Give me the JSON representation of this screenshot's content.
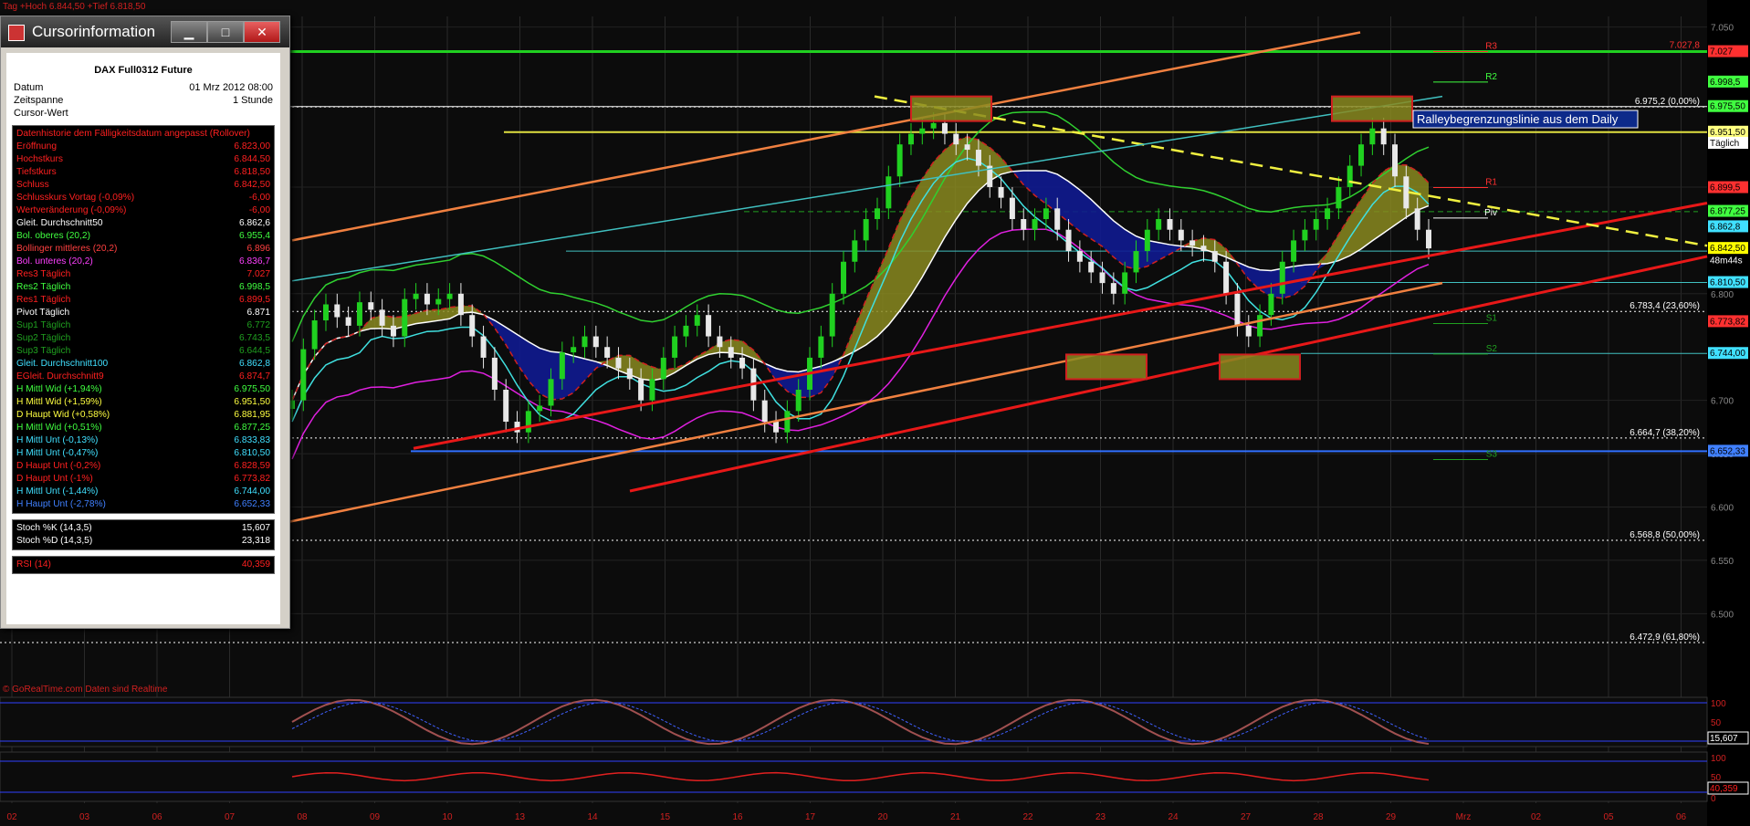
{
  "header": {
    "top_line": "Tag +Hoch 6.844,50 +Tief 6.818,50"
  },
  "footer_source": "© GoRealTime.com   Daten sind Realtime",
  "annotation": "Ralleybegrenzungslinie aus dem Daily",
  "window": {
    "title": "Cursorinformation",
    "min": "▁",
    "max": "□",
    "close": "✕",
    "instrument": "DAX Full0312 Future",
    "meta": [
      {
        "label": "Datum",
        "value": "01 Mrz 2012 08:00"
      },
      {
        "label": "Zeitspanne",
        "value": "1 Stunde"
      },
      {
        "label": "Cursor-Wert",
        "value": ""
      }
    ],
    "section1": [
      {
        "label": "Datenhistorie dem Fälligkeitsdatum angepasst (Rollover)",
        "value": "",
        "color": "#ff2020"
      },
      {
        "label": "Eröffnung",
        "value": "6.823,00",
        "color": "#ff2020"
      },
      {
        "label": "Hochstkurs",
        "value": "6.844,50",
        "color": "#ff2020"
      },
      {
        "label": "Tiefstkurs",
        "value": "6.818,50",
        "color": "#ff2020"
      },
      {
        "label": "Schluss",
        "value": "6.842,50",
        "color": "#ff2020"
      },
      {
        "label": "Schlusskurs Vortag (-0,09%)",
        "value": "-6,00",
        "color": "#ff2020"
      },
      {
        "label": "Wertveränderung (-0,09%)",
        "value": "-6,00",
        "color": "#ff2020"
      },
      {
        "label": "Gleit. Durchschnitt50",
        "value": "6.862,6",
        "color": "#ffffff"
      },
      {
        "label": "Bol. oberes (20,2)",
        "value": "6.955,4",
        "color": "#40ff40"
      },
      {
        "label": "Bollinger mittleres (20,2)",
        "value": "6.896",
        "color": "#ff4040"
      },
      {
        "label": "Bol. unteres (20,2)",
        "value": "6.836,7",
        "color": "#ff40ff"
      },
      {
        "label": "Res3 Täglich",
        "value": "7.027",
        "color": "#ff2020"
      },
      {
        "label": "Res2 Täglich",
        "value": "6.998,5",
        "color": "#40ff40"
      },
      {
        "label": "Res1 Täglich",
        "value": "6.899,5",
        "color": "#ff2020"
      },
      {
        "label": "Pivot Täglich",
        "value": "6.871",
        "color": "#ffffff"
      },
      {
        "label": "Sup1 Täglich",
        "value": "6.772",
        "color": "#20a020"
      },
      {
        "label": "Sup2 Täglich",
        "value": "6.743,5",
        "color": "#20a020"
      },
      {
        "label": "Sup3 Täglich",
        "value": "6.644,5",
        "color": "#20a020"
      },
      {
        "label": "Gleit. Durchschnitt100",
        "value": "6.862,8",
        "color": "#40e0ff"
      },
      {
        "label": "EGleit. Durchschnitt9",
        "value": "6.874,7",
        "color": "#ff2020"
      },
      {
        "label": "H Mittl Wid (+1,94%)",
        "value": "6.975,50",
        "color": "#40ff40"
      },
      {
        "label": "H Mittl Wid (+1,59%)",
        "value": "6.951,50",
        "color": "#ffff40"
      },
      {
        "label": "D Haupt Wid (+0,58%)",
        "value": "6.881,95",
        "color": "#ffff40"
      },
      {
        "label": "H Mittl Wid (+0,51%)",
        "value": "6.877,25",
        "color": "#40ff40"
      },
      {
        "label": "H Mittl Unt (-0,13%)",
        "value": "6.833,83",
        "color": "#40e0ff"
      },
      {
        "label": "H Mittl Unt (-0,47%)",
        "value": "6.810,50",
        "color": "#40e0ff"
      },
      {
        "label": "D Haupt Unt (-0,2%)",
        "value": "6.828,59",
        "color": "#ff2020"
      },
      {
        "label": "D Haupt Unt (-1%)",
        "value": "6.773,82",
        "color": "#ff2020"
      },
      {
        "label": "H Mittl Unt (-1,44%)",
        "value": "6.744,00",
        "color": "#40e0ff"
      },
      {
        "label": "H Haupt Unt (-2,78%)",
        "value": "6.652,33",
        "color": "#4080ff"
      }
    ],
    "section2": [
      {
        "label": "Stoch %K (14,3,5)",
        "value": "15,607",
        "color": "#ffffff"
      },
      {
        "label": "Stoch %D (14,3,5)",
        "value": "23,318",
        "color": "#ffffff"
      }
    ],
    "section3": [
      {
        "label": "RSI (14)",
        "value": "40,359",
        "color": "#ff2020"
      }
    ]
  },
  "chart_data": {
    "type": "candlestick",
    "instrument": "DAX Full0312 Future",
    "timeframe": "1 Stunde",
    "x_tick_labels": [
      "02",
      "03",
      "06",
      "07",
      "08",
      "09",
      "10",
      "13",
      "14",
      "15",
      "16",
      "17",
      "20",
      "21",
      "22",
      "23",
      "24",
      "27",
      "28",
      "29",
      "Mrz",
      "02",
      "05",
      "06"
    ],
    "y_axis_labels": [
      {
        "label": "7.050",
        "y": 7050
      },
      {
        "label": "6.900",
        "y": 6900
      },
      {
        "label": "6.800",
        "y": 6800
      },
      {
        "label": "6.700",
        "y": 6700
      },
      {
        "label": "6.650",
        "y": 6650
      },
      {
        "label": "6.600",
        "y": 6600
      },
      {
        "label": "6.550",
        "y": 6550
      },
      {
        "label": "6.500",
        "y": 6500
      }
    ],
    "ylim": [
      6425,
      7060
    ],
    "closes": [
      6700,
      6748,
      6775,
      6790,
      6778,
      6770,
      6792,
      6785,
      6770,
      6760,
      6795,
      6800,
      6790,
      6795,
      6800,
      6780,
      6760,
      6740,
      6710,
      6680,
      6670,
      6690,
      6695,
      6720,
      6745,
      6750,
      6760,
      6750,
      6740,
      6730,
      6720,
      6700,
      6720,
      6740,
      6760,
      6770,
      6780,
      6760,
      6750,
      6740,
      6730,
      6700,
      6680,
      6670,
      6690,
      6710,
      6740,
      6760,
      6800,
      6830,
      6850,
      6870,
      6880,
      6910,
      6940,
      6950,
      6955,
      6960,
      6950,
      6940,
      6935,
      6920,
      6900,
      6890,
      6870,
      6860,
      6870,
      6880,
      6860,
      6840,
      6830,
      6820,
      6810,
      6800,
      6820,
      6840,
      6860,
      6870,
      6860,
      6850,
      6845,
      6840,
      6830,
      6800,
      6770,
      6760,
      6780,
      6800,
      6830,
      6850,
      6860,
      6870,
      6880,
      6900,
      6920,
      6940,
      6955,
      6940,
      6910,
      6880,
      6860,
      6842.5
    ],
    "horizontal_levels": [
      {
        "label": "7.027,8",
        "value": 7027.8,
        "color": "#ff3030"
      },
      {
        "label": "6.975,2 (0,00%)",
        "value": 6975.2,
        "color": "#ffffff"
      },
      {
        "label": "6.783,4 (23,60%)",
        "value": 6783.4,
        "color": "#ffffff"
      },
      {
        "label": "6.664,7 (38,20%)",
        "value": 6664.7,
        "color": "#ffffff"
      },
      {
        "label": "6.568,8 (50,00%)",
        "value": 6568.8,
        "color": "#ffffff"
      },
      {
        "label": "6.472,9 (61,80%)",
        "value": 6472.9,
        "color": "#ffffff"
      }
    ],
    "pivot_labels": [
      {
        "label": "R3",
        "value": 7027,
        "color": "#ff3030"
      },
      {
        "label": "R2",
        "value": 6998.5,
        "color": "#40ff40"
      },
      {
        "label": "R1",
        "value": 6899.5,
        "color": "#ff3030"
      },
      {
        "label": "Piv",
        "value": 6871,
        "color": "#ffffff"
      },
      {
        "label": "S1",
        "value": 6772,
        "color": "#20a020"
      },
      {
        "label": "S2",
        "value": 6743.5,
        "color": "#20a020"
      },
      {
        "label": "S3",
        "value": 6644.5,
        "color": "#20a020"
      }
    ],
    "price_tags": [
      {
        "label": "7.027",
        "value": 7027,
        "bg": "#ff3030",
        "fg": "#000000"
      },
      {
        "label": "6.998,5",
        "value": 6998.5,
        "bg": "#40ff40",
        "fg": "#000000"
      },
      {
        "label": "6.975,50",
        "value": 6975.5,
        "bg": "#40ff40",
        "fg": "#000000"
      },
      {
        "label": "6.951,50",
        "value": 6951.5,
        "bg": "#ffff80",
        "fg": "#000000"
      },
      {
        "label": "Täglich",
        "value": 6941,
        "bg": "#ffffff",
        "fg": "#000000"
      },
      {
        "label": "6.899,5",
        "value": 6899.5,
        "bg": "#ff3030",
        "fg": "#000000"
      },
      {
        "label": "6.877,25",
        "value": 6877.25,
        "bg": "#40ff40",
        "fg": "#000000"
      },
      {
        "label": "6.862,8",
        "value": 6862.8,
        "bg": "#40e0ff",
        "fg": "#000000"
      },
      {
        "label": "6.842,50",
        "value": 6842.5,
        "bg": "#ffff00",
        "fg": "#000000"
      },
      {
        "label": "48m44s",
        "value": 6831,
        "bg": "#000000",
        "fg": "#ffffff"
      },
      {
        "label": "6.810,50",
        "value": 6810.5,
        "bg": "#40e0ff",
        "fg": "#000000"
      },
      {
        "label": "6.773,82",
        "value": 6773.82,
        "bg": "#ff3030",
        "fg": "#000000"
      },
      {
        "label": "6.744,00",
        "value": 6744,
        "bg": "#40e0ff",
        "fg": "#000000"
      },
      {
        "label": "6.652,33",
        "value": 6652.33,
        "bg": "#4080ff",
        "fg": "#000000"
      }
    ],
    "stochastic": {
      "ylim": [
        0,
        100
      ],
      "axis_labels": [
        "100",
        "50",
        "0"
      ],
      "k_last": "15,607",
      "d_last": "23,318"
    },
    "rsi": {
      "ylim": [
        0,
        100
      ],
      "axis_labels": [
        "100",
        "50",
        "0"
      ],
      "last": "40,359"
    }
  }
}
